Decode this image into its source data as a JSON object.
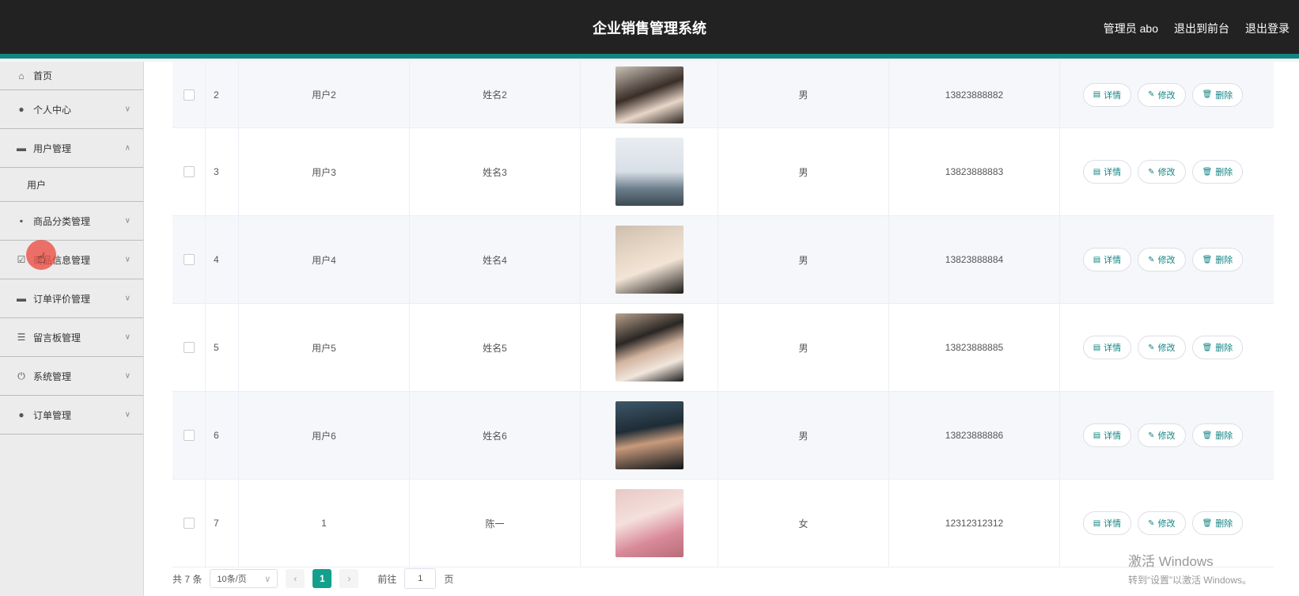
{
  "header": {
    "title": "企业销售管理系统",
    "admin": "管理员 abo",
    "exit_front": "退出到前台",
    "logout": "退出登录"
  },
  "sidebar": {
    "items": [
      {
        "label": "首页",
        "icon": "home-icon"
      },
      {
        "label": "个人中心",
        "icon": "user-icon"
      },
      {
        "label": "用户管理",
        "icon": "monitor-icon",
        "expanded": true
      },
      {
        "label": "用户",
        "sub": true
      },
      {
        "label": "商品分类管理",
        "icon": "category-icon"
      },
      {
        "label": "商品信息管理",
        "icon": "clipboard-icon"
      },
      {
        "label": "订单评价管理",
        "icon": "monitor-icon"
      },
      {
        "label": "留言板管理",
        "icon": "sliders-icon"
      },
      {
        "label": "系统管理",
        "icon": "power-icon"
      },
      {
        "label": "订单管理",
        "icon": "user-icon"
      }
    ]
  },
  "table": {
    "actions": {
      "detail": "详情",
      "edit": "修改",
      "delete": "删除"
    },
    "rows": [
      {
        "idx": "2",
        "user": "用户2",
        "name": "姓名2",
        "gender": "男",
        "phone": "13823888882"
      },
      {
        "idx": "3",
        "user": "用户3",
        "name": "姓名3",
        "gender": "男",
        "phone": "13823888883"
      },
      {
        "idx": "4",
        "user": "用户4",
        "name": "姓名4",
        "gender": "男",
        "phone": "13823888884"
      },
      {
        "idx": "5",
        "user": "用户5",
        "name": "姓名5",
        "gender": "男",
        "phone": "13823888885"
      },
      {
        "idx": "6",
        "user": "用户6",
        "name": "姓名6",
        "gender": "男",
        "phone": "13823888886"
      },
      {
        "idx": "7",
        "user": "1",
        "name": "陈一",
        "gender": "女",
        "phone": "12312312312"
      }
    ]
  },
  "pagination": {
    "total": "共 7 条",
    "page_size": "10条/页",
    "current": "1",
    "goto_prefix": "前往",
    "goto_value": "1",
    "goto_suffix": "页"
  },
  "watermark": {
    "line1": "激活 Windows",
    "line2": "转到“设置”以激活 Windows。"
  },
  "colors": {
    "topbar": "#222222",
    "accent": "#128583",
    "active_page": "#12a08c"
  }
}
